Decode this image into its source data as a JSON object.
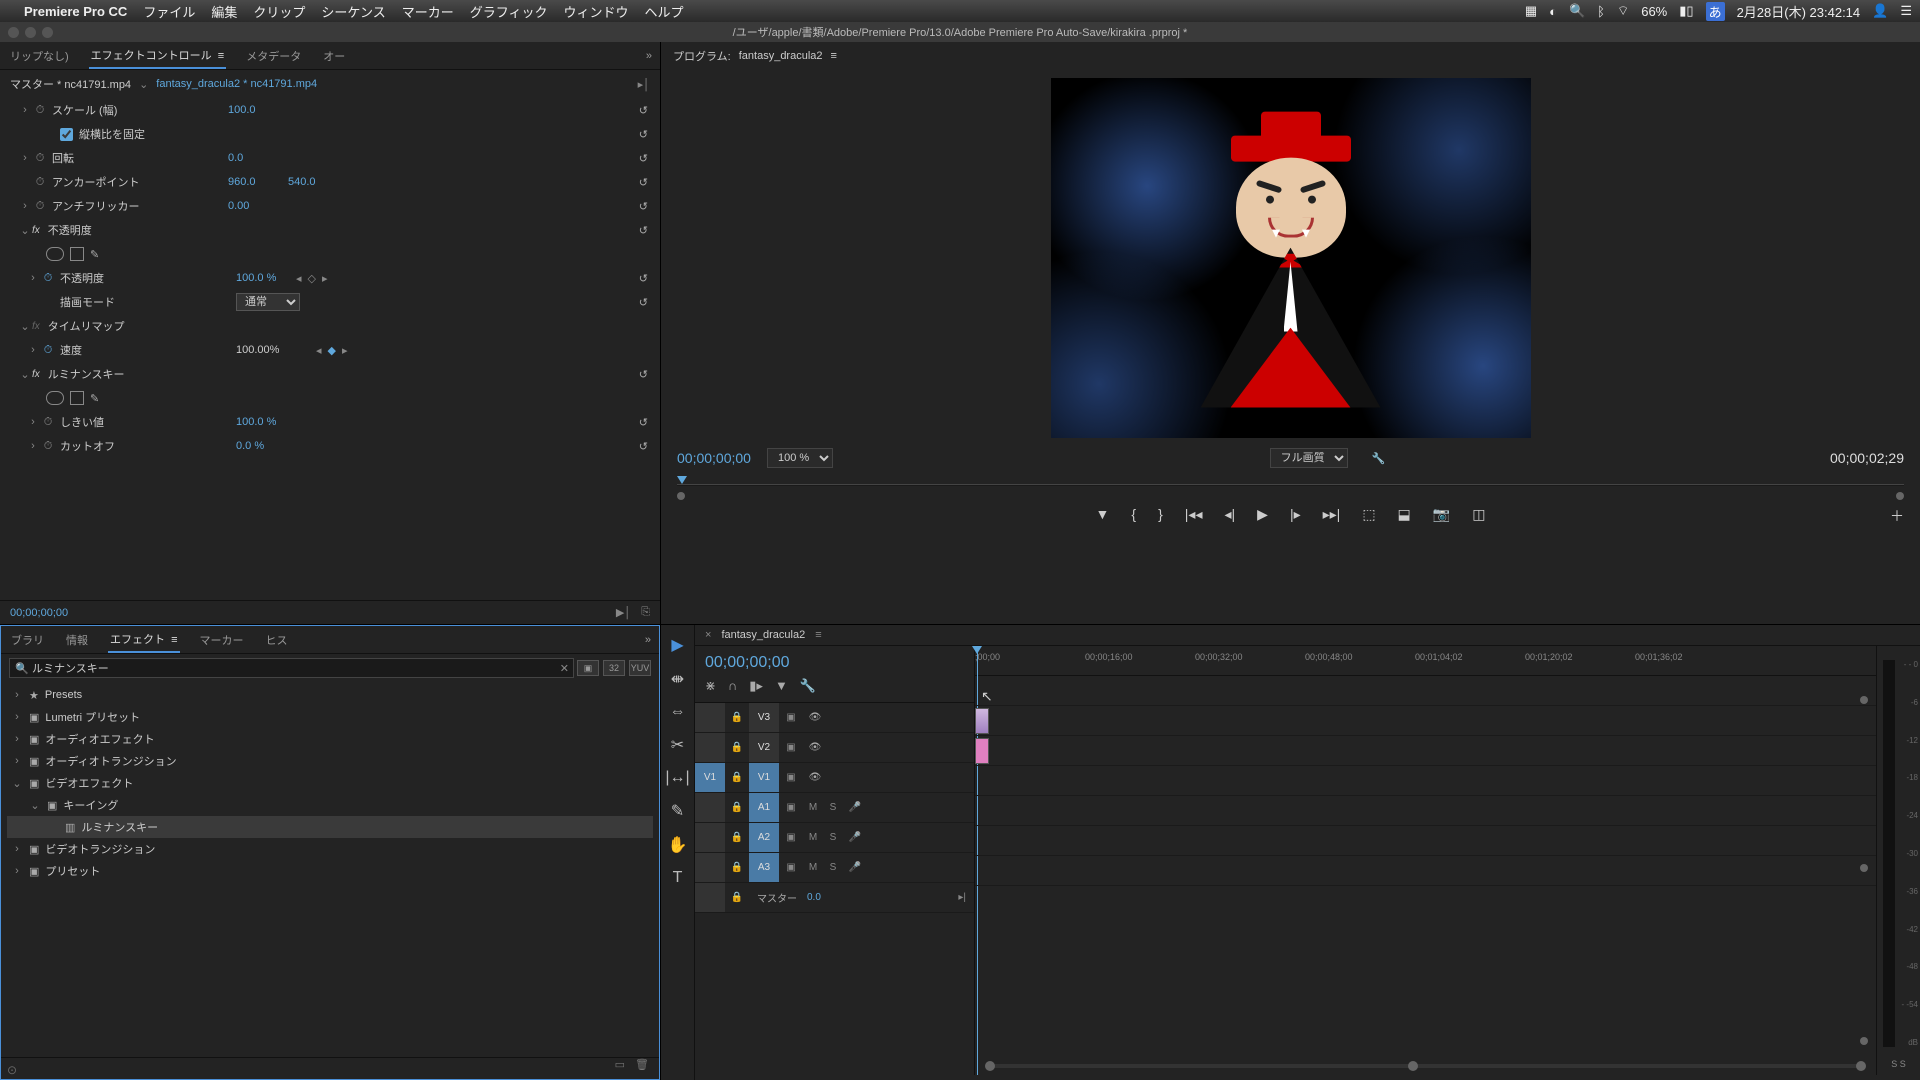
{
  "menubar": {
    "apple": "",
    "app": "Premiere Pro CC",
    "items": [
      "ファイル",
      "編集",
      "クリップ",
      "シーケンス",
      "マーカー",
      "グラフィック",
      "ウィンドウ",
      "ヘルプ"
    ],
    "battery": "66%",
    "ime": "あ",
    "datetime": "2月28日(木)  23:42:14"
  },
  "window": {
    "title": "/ユーザ/apple/書類/Adobe/Premiere Pro/13.0/Adobe Premiere Pro Auto-Save/kirakira .prproj *"
  },
  "effectControls": {
    "tabs": {
      "clipNone": "リップなし)",
      "active": "エフェクトコントロール",
      "meta": "メタデータ",
      "audio": "オー"
    },
    "master": "マスター * nc41791.mp4",
    "seqClip": "fantasy_dracula2 * nc41791.mp4",
    "rows": {
      "scaleW": {
        "label": "スケール (幅)",
        "val": "100.0"
      },
      "lockAspect": {
        "label": "縦横比を固定"
      },
      "rotation": {
        "label": "回転",
        "val": "0.0"
      },
      "anchor": {
        "label": "アンカーポイント",
        "x": "960.0",
        "y": "540.0"
      },
      "antiflicker": {
        "label": "アンチフリッカー",
        "val": "0.00"
      },
      "opacityGroup": {
        "label": "不透明度"
      },
      "opacity": {
        "label": "不透明度",
        "val": "100.0 %"
      },
      "blendMode": {
        "label": "描画モード",
        "val": "通常"
      },
      "timeRemap": {
        "label": "タイムリマップ"
      },
      "speed": {
        "label": "速度",
        "val": "100.00%"
      },
      "lumaKey": {
        "label": "ルミナンスキー"
      },
      "threshold": {
        "label": "しきい値",
        "val": "100.0 %"
      },
      "cutoff": {
        "label": "カットオフ",
        "val": "0.0 %"
      }
    },
    "timecode": "00;00;00;00"
  },
  "program": {
    "label": "プログラム:",
    "seq": "fantasy_dracula2",
    "tc": "00;00;00;00",
    "zoom": "100 %",
    "quality": "フル画質",
    "duration": "00;00;02;29"
  },
  "effectsPanel": {
    "tabs": {
      "library": "ブラリ",
      "info": "情報",
      "active": "エフェクト",
      "marker": "マーカー",
      "history": "ヒス"
    },
    "search": "ルミナンスキー",
    "tree": [
      {
        "tw": "›",
        "icon": "★",
        "label": "Presets"
      },
      {
        "tw": "›",
        "icon": "▣",
        "label": "Lumetri プリセット"
      },
      {
        "tw": "›",
        "icon": "▣",
        "label": "オーディオエフェクト"
      },
      {
        "tw": "›",
        "icon": "▣",
        "label": "オーディオトランジション"
      },
      {
        "tw": "⌄",
        "icon": "▣",
        "label": "ビデオエフェクト"
      },
      {
        "tw": "⌄",
        "icon": "▣",
        "label": "キーイング",
        "indent": 1
      },
      {
        "tw": "",
        "icon": "▥",
        "label": "ルミナンスキー",
        "indent": 2,
        "sel": true
      },
      {
        "tw": "›",
        "icon": "▣",
        "label": "ビデオトランジション"
      },
      {
        "tw": "›",
        "icon": "▣",
        "label": "プリセット"
      }
    ]
  },
  "timeline": {
    "seq": "fantasy_dracula2",
    "tc": "00;00;00;00",
    "ruler": [
      ";00;00",
      "00;00;16;00",
      "00;00;32;00",
      "00;00;48;00",
      "00;01;04;02",
      "00;01;20;02",
      "00;01;36;02"
    ],
    "tracks": {
      "v3": "V3",
      "v2": "V2",
      "v1src": "V1",
      "v1": "V1",
      "a1": "A1",
      "a2": "A2",
      "a3": "A3",
      "master": "マスター",
      "masterVal": "0.0"
    },
    "ms": {
      "m": "M",
      "s": "S"
    }
  },
  "meters": {
    "scale": [
      "- - 0",
      "-6",
      "-12",
      "-18",
      "-24",
      "-30",
      "-36",
      "-42",
      "-48",
      "- -54",
      "   dB"
    ],
    "solo": "S  S"
  }
}
